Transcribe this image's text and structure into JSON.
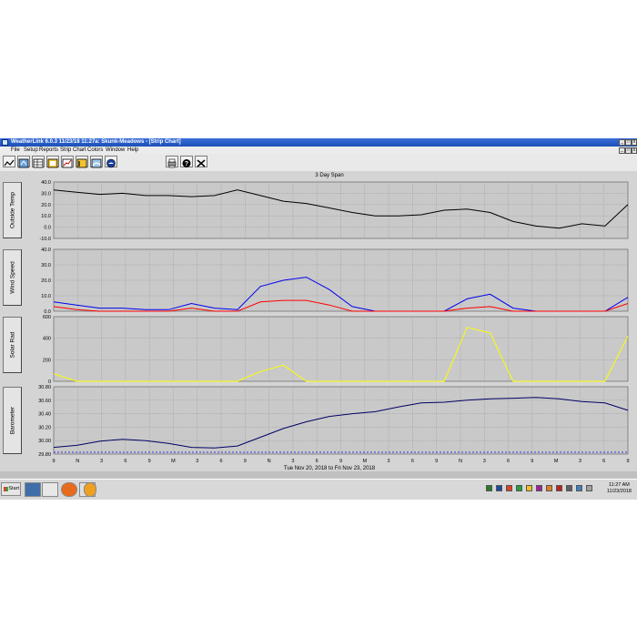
{
  "window": {
    "title": "WeatherLink 6.0.3  11/23/18  11:27a: Skunk-Meadows - [Strip Chart]"
  },
  "menu": [
    "File",
    "Setup",
    "Reports",
    "Strip Chart",
    "Colors",
    "Window",
    "Help"
  ],
  "toolbar": {
    "icons": [
      "strip-chart-icon",
      "summary-icon",
      "table-icon",
      "gauge-icon",
      "graph-icon",
      "calendar-icon",
      "noaa-icon",
      "printer-icon",
      "help-icon",
      "close-x-icon"
    ]
  },
  "chart": {
    "span_label": "3 Day Span",
    "date_range": "Tue Nov 20, 2018  to  Fri Nov 23, 2018",
    "x_ticks": [
      "9",
      "N",
      "3",
      "6",
      "9",
      "M",
      "3",
      "6",
      "9",
      "N",
      "3",
      "6",
      "9",
      "M",
      "3",
      "6",
      "9",
      "N",
      "3",
      "6",
      "9",
      "M",
      "3",
      "6",
      "9"
    ],
    "panels": [
      {
        "label": "Outside Temp",
        "y_ticks": [
          "40.0",
          "30.0",
          "20.0",
          "10.0",
          "0.0",
          "-10.0"
        ]
      },
      {
        "label": "Wind Speed",
        "y_ticks": [
          "40.0",
          "30.0",
          "20.0",
          "10.0",
          "0.0"
        ]
      },
      {
        "label": "Solar Rad",
        "y_ticks": [
          "600",
          "400",
          "200",
          "0"
        ]
      },
      {
        "label": "Barometer",
        "y_ticks": [
          "30.80",
          "30.60",
          "30.40",
          "30.20",
          "30.00",
          "29.80"
        ]
      }
    ]
  },
  "chart_data": {
    "type": "line",
    "x_hours": [
      0,
      3,
      6,
      9,
      12,
      15,
      18,
      21,
      24,
      27,
      30,
      33,
      36,
      39,
      42,
      45,
      48,
      51,
      54,
      57,
      60,
      63,
      66,
      69,
      72
    ],
    "series": [
      {
        "panel": 0,
        "color": "#000000",
        "ylim": [
          -10,
          40
        ],
        "values": [
          33,
          31,
          29,
          30,
          28,
          28,
          27,
          28,
          33,
          28,
          23,
          21,
          17,
          13,
          10,
          10,
          11,
          15,
          16,
          13,
          5,
          1,
          -1,
          3,
          1,
          20
        ]
      },
      {
        "panel": 1,
        "color": "#0000ee",
        "ylim": [
          0,
          40
        ],
        "values": [
          6,
          4,
          2,
          2,
          1,
          1,
          5,
          2,
          1,
          16,
          20,
          22,
          14,
          3,
          0,
          0,
          0,
          0,
          8,
          11,
          2,
          0,
          0,
          0,
          0,
          9
        ]
      },
      {
        "panel": 1,
        "color": "#ff0000",
        "ylim": [
          0,
          40
        ],
        "values": [
          3,
          1,
          0,
          0,
          0,
          0,
          2,
          0,
          0,
          6,
          7,
          7,
          4,
          0,
          0,
          0,
          0,
          0,
          2,
          3,
          0,
          0,
          0,
          0,
          0,
          5
        ]
      },
      {
        "panel": 2,
        "color": "#ffff00",
        "ylim": [
          0,
          600
        ],
        "values": [
          70,
          0,
          0,
          0,
          0,
          0,
          0,
          0,
          0,
          90,
          150,
          0,
          0,
          0,
          0,
          0,
          0,
          0,
          500,
          450,
          0,
          0,
          0,
          0,
          0,
          420
        ]
      },
      {
        "panel": 3,
        "color": "#000066",
        "ylim": [
          29.8,
          30.8
        ],
        "values": [
          29.9,
          29.93,
          29.99,
          30.02,
          30.0,
          29.96,
          29.9,
          29.89,
          29.92,
          30.05,
          30.18,
          30.28,
          30.36,
          30.4,
          30.43,
          30.5,
          30.56,
          30.57,
          30.6,
          30.62,
          30.63,
          30.64,
          30.62,
          30.58,
          30.56,
          30.45
        ]
      }
    ]
  },
  "taskbar": {
    "start_label": "Start",
    "clock_time": "11:27 AM",
    "clock_date": "11/23/2018"
  }
}
